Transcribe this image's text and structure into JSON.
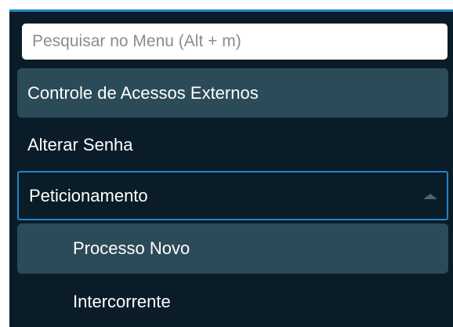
{
  "search": {
    "placeholder": "Pesquisar no Menu (Alt + m)"
  },
  "menu": {
    "items": [
      {
        "label": "Controle de Acessos Externos",
        "state": "hover"
      },
      {
        "label": "Alterar Senha"
      },
      {
        "label": "Peticionamento",
        "expanded": true,
        "icon": "caret-up-icon"
      }
    ],
    "submenu": [
      {
        "label": "Processo Novo",
        "state": "hover"
      },
      {
        "label": "Intercorrente"
      }
    ]
  },
  "colors": {
    "panel_background": "#091c28",
    "highlight": "#2c4b58",
    "accent_border": "#1f86c9",
    "text": "#ffffff"
  }
}
